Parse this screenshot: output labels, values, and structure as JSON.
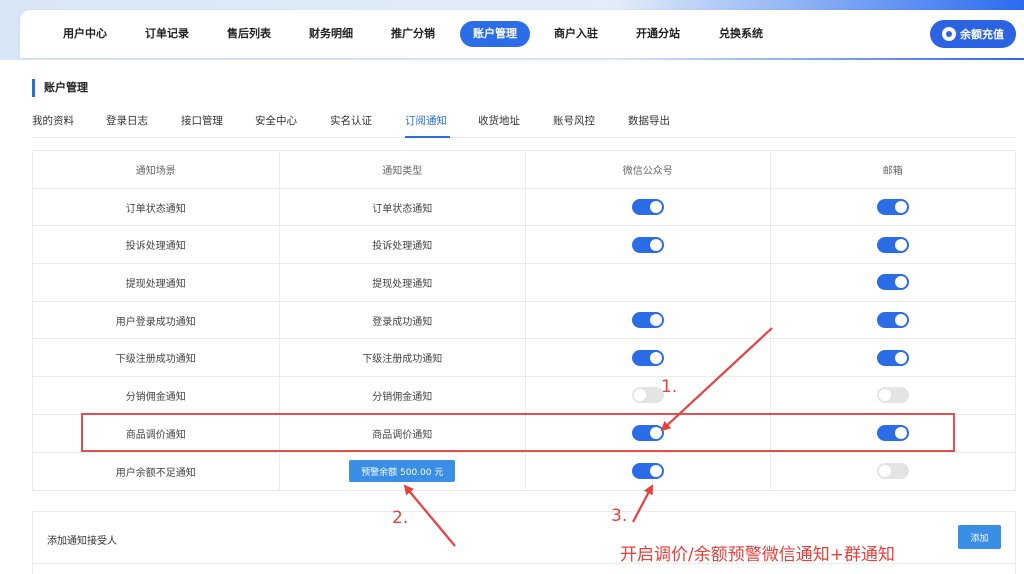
{
  "nav": {
    "items": [
      "用户中心",
      "订单记录",
      "售后列表",
      "财务明细",
      "推广分销",
      "账户管理",
      "商户入驻",
      "开通分站",
      "兑换系统"
    ],
    "active_index": 5,
    "recharge_label": "余额充值"
  },
  "section": {
    "title": "账户管理"
  },
  "subtabs": {
    "items": [
      "我的资料",
      "登录日志",
      "接口管理",
      "安全中心",
      "实名认证",
      "订阅通知",
      "收货地址",
      "账号风控",
      "数据导出"
    ],
    "active_index": 5
  },
  "table": {
    "headers": [
      "通知场景",
      "通知类型",
      "微信公众号",
      "邮箱"
    ],
    "rows": [
      {
        "scene": "订单状态通知",
        "type": "订单状态通知",
        "wechat": "on",
        "email": "on"
      },
      {
        "scene": "投诉处理通知",
        "type": "投诉处理通知",
        "wechat": "on",
        "email": "on"
      },
      {
        "scene": "提现处理通知",
        "type": "提现处理通知",
        "wechat": "none",
        "email": "on"
      },
      {
        "scene": "用户登录成功通知",
        "type": "登录成功通知",
        "wechat": "on",
        "email": "on"
      },
      {
        "scene": "下级注册成功通知",
        "type": "下级注册成功通知",
        "wechat": "on",
        "email": "on"
      },
      {
        "scene": "分销佣金通知",
        "type": "分销佣金通知",
        "wechat": "off",
        "email": "off"
      },
      {
        "scene": "商品调价通知",
        "type": "商品调价通知",
        "wechat": "on",
        "email": "on"
      },
      {
        "scene": "用户余额不足通知",
        "type": "",
        "wechat": "on",
        "email": "off"
      }
    ],
    "warn_button_label": "预警余额 500.00 元"
  },
  "recipients": {
    "label": "添加通知接受人",
    "add_label": "添加"
  },
  "annotations": {
    "n1": "1.",
    "n2": "2.",
    "n3": "3.",
    "note": "开启调价/余额预警微信通知+群通知",
    "color": "#e8403c"
  },
  "colors": {
    "accent": "#2b6de6",
    "toggle_off": "#e4e4e4"
  }
}
